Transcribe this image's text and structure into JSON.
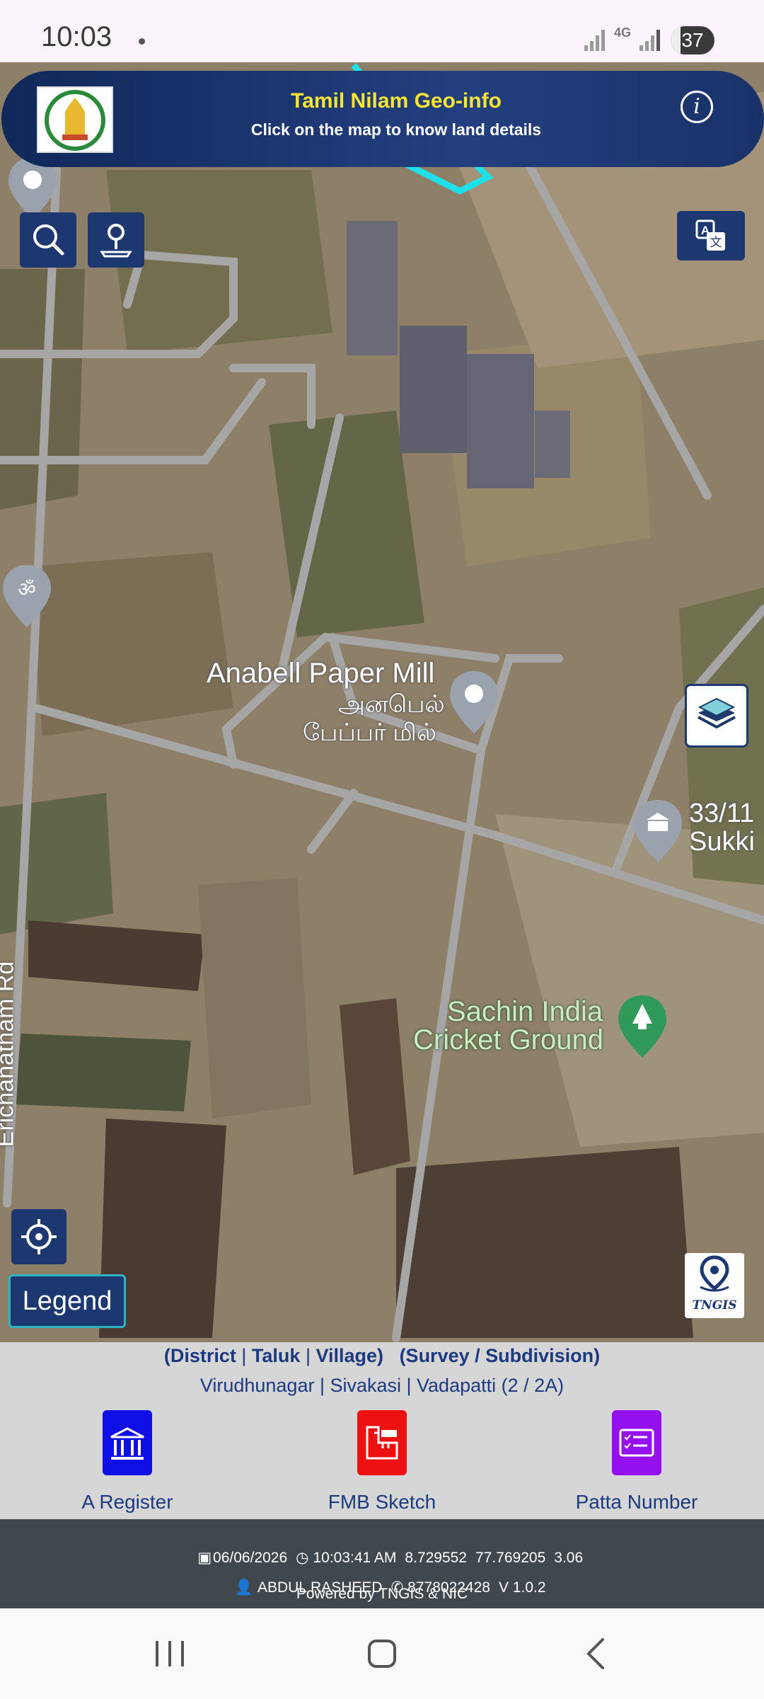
{
  "status_bar": {
    "time": "10:03",
    "network": "4G",
    "battery": "37"
  },
  "header": {
    "title": "Tamil Nilam Geo-info",
    "subtitle": "Click on the map to know land details",
    "info_icon": "info-icon",
    "title_color": "#f7e533"
  },
  "map": {
    "labels": {
      "paper_mill_en": "Anabell Paper Mill",
      "paper_mill_ta": "அனபெல்",
      "paper_mill_ta2": "பேப்பர் மில்",
      "cricket_1": "Sachin India",
      "cricket_2": "Cricket Ground",
      "road": "Erichanatham Rd",
      "survey_1": "33/11",
      "survey_2": "Sukki"
    },
    "controls": {
      "search_icon": "search-icon",
      "user_icon": "user-pin-icon",
      "translate_icon": "translate-icon",
      "layers_icon": "layers-icon",
      "locate_icon": "crosshair-icon",
      "legend": "Legend",
      "brand": "TNGIS"
    }
  },
  "location": {
    "heading_parts": [
      "(District",
      "Taluk",
      "Village)",
      "(Survey / Subdivision)"
    ],
    "value": "Virudhunagar | Sivakasi | Vadapatti (2 / 2A)"
  },
  "actions": [
    {
      "label": "A Register",
      "color": "#1010e6",
      "icon": "bank-icon"
    },
    {
      "label": "FMB Sketch",
      "color": "#ee1111",
      "icon": "ruler-icon"
    },
    {
      "label": "Patta Number",
      "color": "#9410ee",
      "icon": "id-card-icon"
    }
  ],
  "footer": {
    "date": "06/06/2026",
    "time": "10:03:41 AM",
    "lat": "8.729552",
    "lon": "77.769205",
    "accuracy": "3.06",
    "user": "ABDUL RASHEED",
    "phone": "8778022428",
    "version": "V 1.0.2",
    "powered": "Powered by TNGIS & NIC"
  }
}
